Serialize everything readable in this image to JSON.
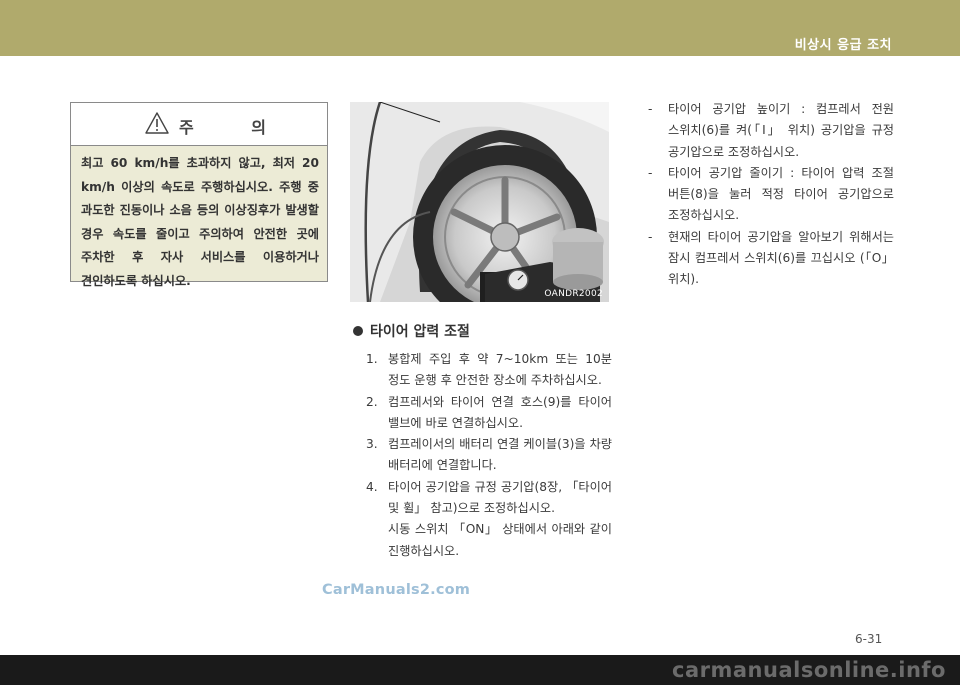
{
  "header": {
    "title": "비상시 응급 조치"
  },
  "caution": {
    "title": "주 의",
    "body": "최고 60 km/h를 초과하지 않고, 최저 20 km/h 이상의 속도로 주행하십시오. 주행 중 과도한 진동이나 소음 등의 이상징후가 발생할 경우 속도를 줄이고 주의하여 안전한 곳에 주차한 후 자사 서비스를 이용하거나 견인하도록 하십시오."
  },
  "photo": {
    "code": "OANDR2002",
    "icon": "tire-compressor-photo"
  },
  "section": {
    "title": "타이어 압력 조절",
    "steps": [
      {
        "num": "1.",
        "text": "봉합제 주입 후 약 7~10km 또는 10분 정도 운행 후 안전한 장소에 주차하십시오."
      },
      {
        "num": "2.",
        "text": "컴프레서와 타이어 연결 호스(9)를 타이어 밸브에 바로 연결하십시오."
      },
      {
        "num": "3.",
        "text": "컴프레이서의 배터리 연결 케이블(3)을 차량 배터리에 연결합니다."
      },
      {
        "num": "4.",
        "text": "타이어 공기압을 규정 공기압(8장, 「타이어 및 휠」 참고)으로 조정하십시오.",
        "extra": "시동 스위치 「ON」 상태에서 아래와 같이 진행하십시오."
      }
    ]
  },
  "right_list": [
    {
      "dash": "-",
      "text": "타이어 공기압 높이기 : 컴프레서 전원 스위치(6)를 켜(「I」 위치) 공기압을 규정 공기압으로 조정하십시오."
    },
    {
      "dash": "-",
      "text": "타이어 공기압 줄이기 : 타이어 압력 조절 버튼(8)을 눌러 적정 타이어 공기압으로 조정하십시오."
    },
    {
      "dash": "-",
      "text": "현재의 타이어 공기압을 알아보기 위해서는 잠시 컴프레서 스위치(6)를 끄십시오 (「O」 위치)."
    }
  ],
  "watermark": "CarManuals2.com",
  "page_number": "6-31",
  "footer_watermark": "carmanualsonline.info"
}
